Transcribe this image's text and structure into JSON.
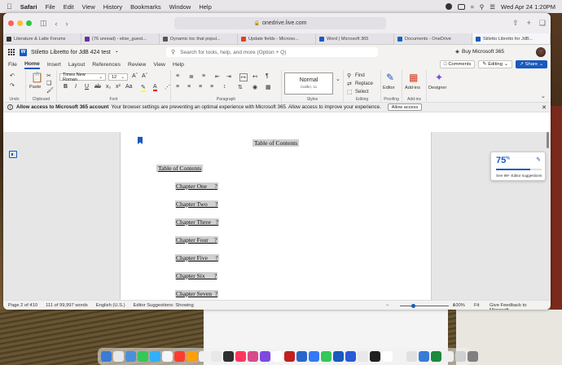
{
  "menubar": {
    "app": "Safari",
    "items": [
      "File",
      "Edit",
      "View",
      "History",
      "Bookmarks",
      "Window",
      "Help"
    ],
    "datetime": "Wed Apr 24  1:20PM"
  },
  "browser": {
    "url": "onedrive.live.com",
    "tabs": [
      {
        "title": "Literature & Latte Forums",
        "color": "#333333"
      },
      {
        "title": "(76 unread) - elise_guest...",
        "color": "#6a2fa0"
      },
      {
        "title": "Dynamic toc that popul...",
        "color": "#555555"
      },
      {
        "title": "Update fields - Microso...",
        "color": "#e04020"
      },
      {
        "title": "Word | Microsoft 365",
        "color": "#185abd"
      },
      {
        "title": "Documents - OneDrive",
        "color": "#0a64c8"
      },
      {
        "title": "Stiletto Libretto for JdB...",
        "color": "#185abd"
      }
    ]
  },
  "word": {
    "doc_title": "Stiletto Libretto for JdB  424 test",
    "search_placeholder": "Search for tools, help, and more (Option + Q)",
    "buy_label": "Buy Microsoft 365",
    "ribbon_tabs": [
      "File",
      "Home",
      "Insert",
      "Layout",
      "References",
      "Review",
      "View",
      "Help"
    ],
    "comments_label": "Comments",
    "editing_label": "Editing",
    "share_label": "Share",
    "font_name": "Times New Roman",
    "font_size": "12",
    "style_name": "Normal",
    "style_sub": "Calibri, 11",
    "groups": {
      "undo": "Undo",
      "clipboard": "Clipboard",
      "font": "Font",
      "paragraph": "Paragraph",
      "styles": "Styles",
      "editing": "Editing",
      "proofing": "Proofing",
      "addins": "Add-ins"
    },
    "paste_label": "Paste",
    "find_label": "Find",
    "replace_label": "Replace",
    "select_label": "Select",
    "editor_label": "Editor",
    "addins_label": "Add-ins",
    "designer_label": "Designer"
  },
  "notification": {
    "bold": "Allow access to Microsoft 365 account",
    "text": "Your browser settings are preventing an optimal experience with Microsoft 365. Allow access to improve your experience.",
    "button": "Allow access"
  },
  "document": {
    "heading": "Table of Contents",
    "toc_label": "Table of Contents ",
    "chapters": [
      "Chapter One     ?",
      "Chapter Two     ?",
      "Chapter Three   ?",
      "Chapter Four    ?",
      "Chapter Five     ?",
      "Chapter Six      ?",
      "Chapter Seven  ?"
    ]
  },
  "editor_panel": {
    "score": "75",
    "score_unit": "%",
    "score_fraction": 0.75,
    "suggestions": "See 99+ Editor suggestions"
  },
  "status": {
    "page": "Page 2 of 410",
    "words": "111 of 99,997 words",
    "language": "English (U.S.)",
    "editor": "Editor Suggestions: Showing",
    "zoom": "100%",
    "fit": "Fit",
    "feedback": "Give Feedback to Microsoft"
  },
  "dock_colors": [
    "#3a7bd5",
    "#e8e8e8",
    "#4a90d9",
    "#34c759",
    "#30b0ff",
    "#f5f5f5",
    "#ff3b30",
    "#ff9f0a",
    "#f0f0f0",
    "#e8e8e8",
    "#2f2f2f",
    "#ff375f",
    "#d84a8a",
    "#7d4ae0",
    "#ffffff",
    "#c02020",
    "#2a66c8",
    "#3478f6",
    "#34c759",
    "#185abd",
    "#2a5bd7",
    "#e8e8e8",
    "#202020",
    "#ffffff",
    "#f2f2f2",
    "#e0e0e0",
    "#3a7bd5",
    "#1b8a3c",
    "#f0f0f0",
    "#d0d0d0",
    "#808080"
  ]
}
